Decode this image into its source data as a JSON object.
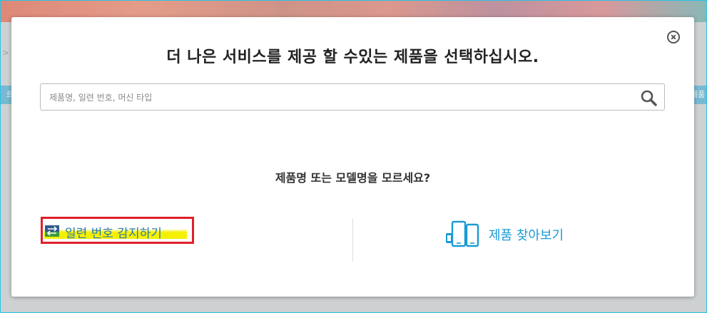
{
  "background": {
    "left_tab_text": "르",
    "right_tab_text": "제품",
    "arrow_glyph": ">"
  },
  "modal": {
    "title": "더 나은 서비스를 제공 할 수있는 제품을 선택하십시오.",
    "search": {
      "placeholder": "제품명, 일련 번호, 머신 타입",
      "value": ""
    },
    "question": "제품명 또는 모델명을 모르세요?",
    "detect_serial_label": "일련 번호 감지하기",
    "browse_products_label": "제품 찾아보기"
  },
  "colors": {
    "accent_blue": "#1b9bd4",
    "highlight_border": "#e0202a",
    "highlight_marker": "#f4f000",
    "frame_border": "#27c3e6"
  },
  "icons": {
    "close": "close-circle-icon",
    "search": "search-icon",
    "detect_serial": "serial-detect-icon",
    "browse_products": "devices-icon"
  }
}
